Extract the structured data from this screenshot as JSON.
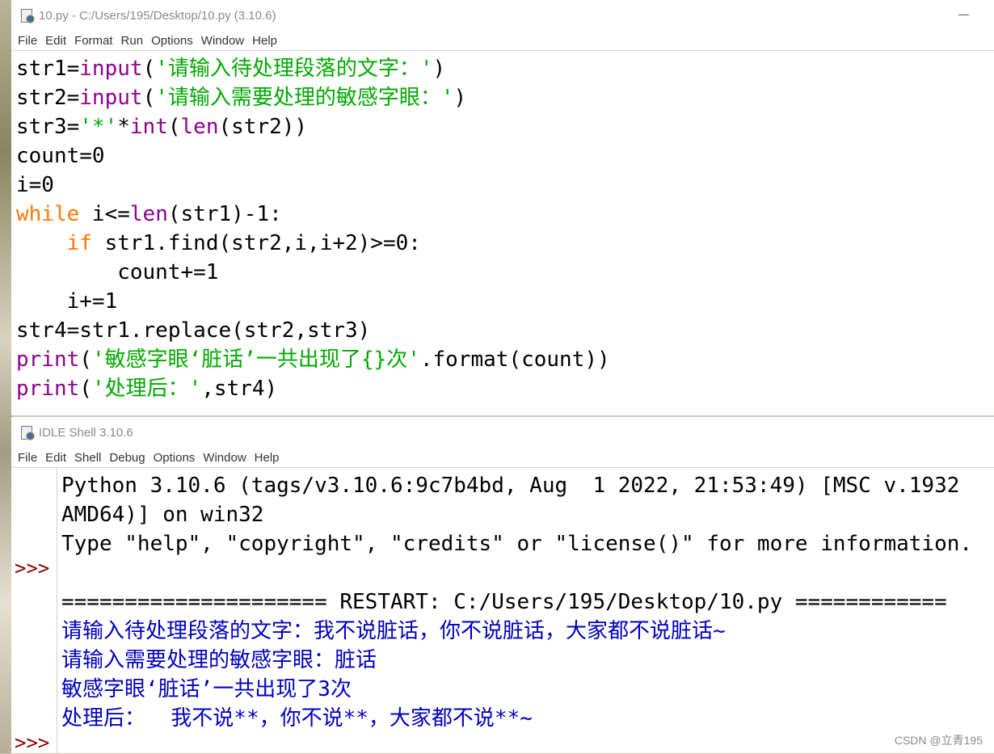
{
  "editor": {
    "title": "10.py - C:/Users/195/Desktop/10.py (3.10.6)",
    "menu": [
      "File",
      "Edit",
      "Format",
      "Run",
      "Options",
      "Window",
      "Help"
    ],
    "code": [
      "str1=input('请输入待处理段落的文字：')",
      "str2=input('请输入需要处理的敏感字眼：')",
      "str3='*'*int(len(str2))",
      "count=0",
      "i=0",
      "while i<=len(str1)-1:",
      "    if str1.find(str2,i,i+2)>=0:",
      "        count+=1",
      "    i+=1",
      "str4=str1.replace(str2,str3)",
      "print('敏感字眼‘脏话’一共出现了{}次'.format(count))",
      "print('处理后：',str4)"
    ]
  },
  "shell": {
    "title": "IDLE Shell 3.10.6",
    "menu": [
      "File",
      "Edit",
      "Shell",
      "Debug",
      "Options",
      "Window",
      "Help"
    ],
    "prompt": ">>>",
    "lines": [
      {
        "text": "Python 3.10.6 (tags/v3.10.6:9c7b4bd, Aug  1 2022, 21:53:49) [MSC v.1932 ",
        "kind": "normal"
      },
      {
        "text": "AMD64)] on win32",
        "kind": "normal"
      },
      {
        "text": "Type \"help\", \"copyright\", \"credits\" or \"license()\" for more information.",
        "kind": "normal"
      },
      {
        "text": "",
        "kind": "normal"
      },
      {
        "text": "===================== RESTART: C:/Users/195/Desktop/10.py ============",
        "kind": "normal"
      },
      {
        "text": "请输入待处理段落的文字：我不说脏话，你不说脏话，大家都不说脏话~",
        "kind": "out"
      },
      {
        "text": "请输入需要处理的敏感字眼：脏话",
        "kind": "out"
      },
      {
        "text": "敏感字眼‘脏话’一共出现了3次",
        "kind": "out"
      },
      {
        "text": "处理后：  我不说**，你不说**，大家都不说**~",
        "kind": "out"
      }
    ]
  },
  "watermark": "CSDN @立青195",
  "colors": {
    "keyword": "#ff7700",
    "builtin": "#900090",
    "string": "#00aa00",
    "output": "#0000c0",
    "prompt": "#8b0000"
  }
}
